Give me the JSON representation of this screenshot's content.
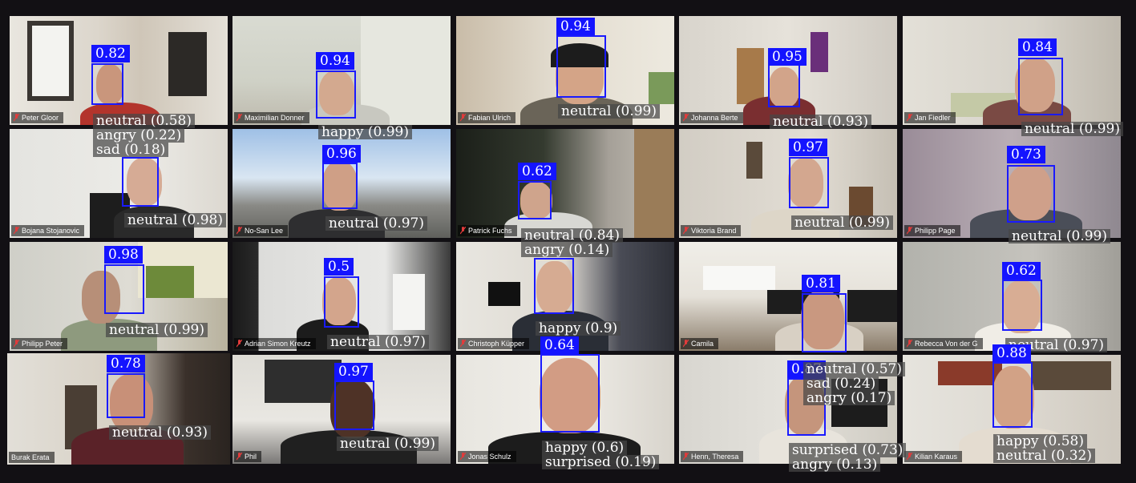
{
  "colors": {
    "background": "#121014",
    "box": "#1a1aff",
    "score_bg": "#1414ff",
    "active_border": "#e8e6a0",
    "mic_muted": "#e23b3b"
  },
  "participants": [
    {
      "name": "Peter Gloor",
      "score": "0.82",
      "emotions": [
        "neutral (0.58)",
        "angry (0.22)",
        "sad (0.18)"
      ]
    },
    {
      "name": "Maximilian Donner",
      "score": "0.94",
      "emotions": [
        "happy (0.99)"
      ]
    },
    {
      "name": "Fabian Ulrich",
      "score": "0.94",
      "emotions": [
        "neutral (0.99)"
      ]
    },
    {
      "name": "Johanna Berte",
      "score": "0.95",
      "emotions": [
        "neutral (0.93)"
      ]
    },
    {
      "name": "Jan Fiedler",
      "score": "0.84",
      "emotions": [
        "neutral (0.99)"
      ]
    },
    {
      "name": "Bojana Stojanovic",
      "score": "",
      "emotions": [
        "neutral (0.98)"
      ]
    },
    {
      "name": "No-San Lee",
      "score": "0.96",
      "emotions": [
        "neutral (0.97)"
      ]
    },
    {
      "name": "Patrick Fuchs",
      "score": "0.62",
      "emotions": [
        "neutral (0.84)",
        "angry (0.14)"
      ]
    },
    {
      "name": "Viktoria Brand",
      "score": "0.97",
      "emotions": [
        "neutral (0.99)"
      ]
    },
    {
      "name": "Philipp Page",
      "score": "0.73",
      "emotions": [
        "neutral (0.99)"
      ]
    },
    {
      "name": "Philipp Peter",
      "score": "0.98",
      "emotions": [
        "neutral (0.99)"
      ]
    },
    {
      "name": "Adrian Simon Kreutz",
      "score": "0.5",
      "emotions": [
        "neutral (0.97)"
      ]
    },
    {
      "name": "Christoph Küpper",
      "score": "",
      "emotions": [
        "happy (0.9)"
      ]
    },
    {
      "name": "Camila",
      "score": "0.81",
      "emotions": []
    },
    {
      "name": "Rebecca Von der G",
      "score": "0.62",
      "emotions": [
        "neutral (0.97)"
      ]
    },
    {
      "name": "Burak Erata",
      "score": "0.78",
      "emotions": [
        "neutral (0.93)"
      ]
    },
    {
      "name": "Phil",
      "score": "0.97",
      "emotions": [
        "neutral (0.99)"
      ]
    },
    {
      "name": "Jonas Schulz",
      "score": "0.64",
      "emotions": [
        "happy (0.6)",
        "surprised (0.19)"
      ]
    },
    {
      "name": "Henn, Theresa",
      "score": "0.87",
      "emotions": [
        "neutral (0.57)",
        "sad (0.24)",
        "angry (0.17)",
        "surprised (0.73)",
        "angry (0.13)"
      ]
    },
    {
      "name": "Kilian Karaus",
      "score": "0.88",
      "emotions": [
        "happy (0.58)",
        "neutral (0.32)"
      ]
    }
  ]
}
